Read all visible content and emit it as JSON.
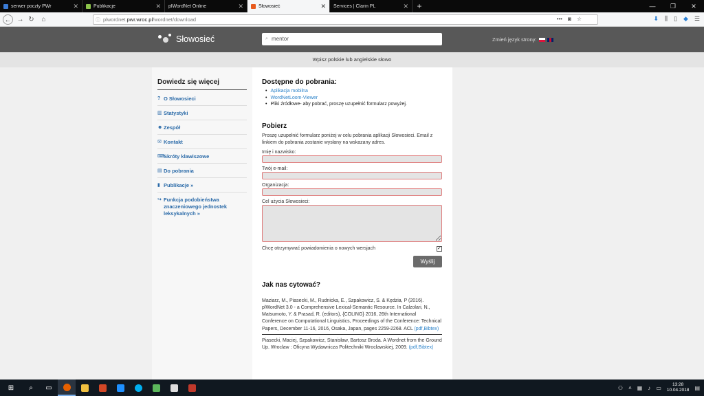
{
  "browser": {
    "tabs": [
      {
        "label": "serwer poczty PWr",
        "color": "#3a7bd5"
      },
      {
        "label": "Publikacje",
        "color": "#8bc34a"
      },
      {
        "label": "plWordNet Online",
        "color": "#cccccc"
      },
      {
        "label": "Słowosieć",
        "color": "#e85a1c",
        "active": true
      },
      {
        "label": "Services | Clarin PL",
        "color": "#cccccc"
      }
    ],
    "new_tab": "+",
    "url_prefix": "plwordnet.",
    "url_host": "pwr.wroc.pl",
    "url_path": "/wordnet/download",
    "window_controls": [
      "—",
      "❐",
      "✕"
    ]
  },
  "site": {
    "logo_name": "Słowosieć",
    "search_value": "mentor",
    "lang_label": "Zmień język strony:",
    "hint": "Wpisz polskie lub angielskie słowo"
  },
  "sidebar": {
    "title": "Dowiedz się więcej",
    "items": [
      {
        "icon": "?",
        "label": "O Słowosieci"
      },
      {
        "icon": "▥",
        "label": "Statystyki"
      },
      {
        "icon": "☻",
        "label": "Zespół"
      },
      {
        "icon": "✉",
        "label": "Kontakt"
      },
      {
        "icon": "⌨",
        "label": "Skróty klawiszowe"
      },
      {
        "icon": "▤",
        "label": "Do pobrania"
      },
      {
        "icon": "▮",
        "label": "Publikacje »"
      },
      {
        "icon": "↪",
        "label": "Funkcja podobieństwa znaczeniowego jednostek leksykalnych »"
      }
    ]
  },
  "main": {
    "available_title": "Dostępne do pobrania:",
    "downloads": [
      {
        "label": "Aplikacja mobilna",
        "link": true
      },
      {
        "label": "WordNetLoom-Viewer",
        "link": true
      },
      {
        "label": "Pliki źródłowe- aby pobrać, proszę uzupełnić formularz powyżej.",
        "link": false
      }
    ],
    "download_title": "Pobierz",
    "download_intro": "Proszę uzupełnić formularz poniżej w celu pobrania aplikacji Słowosieci. Email z linkiem do pobrania zostanie wysłany na wskazany adres.",
    "form": {
      "name_label": "Imię i nazwisko:",
      "email_label": "Twój e-mail:",
      "org_label": "Organizacja:",
      "purpose_label": "Cel użycia Słowosieci:",
      "notify_label": "Chcę otrzymywać powiadomienia o nowych wersjach",
      "notify_checked": true,
      "send_label": "Wyślij"
    },
    "cite_title": "Jak nas cytować?",
    "citations": [
      {
        "text": "Maziarz, M., Piasecki, M., Rudnicka, E., Szpakowicz, S. & Kędzia, P (2016). plWordNet 3.0 - a Comprehensive Lexical-Semantic Resource. In Calzolari, N., Matsumoto, Y. & Prasad, R. (editors), {COLING} 2016, 26th International Conference on Computational Linguistics, Proceedings of the Conference: Technical Papers, December 11-16, 2016, Osaka, Japan, pages 2259-2268. ACL",
        "links": "(pdf,Bibtex)"
      },
      {
        "text": "Piasecki, Maciej, Szpakowicz, Stanisław, Bartosz Broda. A Wordnet from the Ground Up. Wroclaw : Oficyna Wydawnicza Politechniki Wroclawskiej, 2009.",
        "links": "(pdf,Bibtex)"
      }
    ]
  },
  "taskbar": {
    "time": "13:28",
    "date": "10.04.2018"
  }
}
